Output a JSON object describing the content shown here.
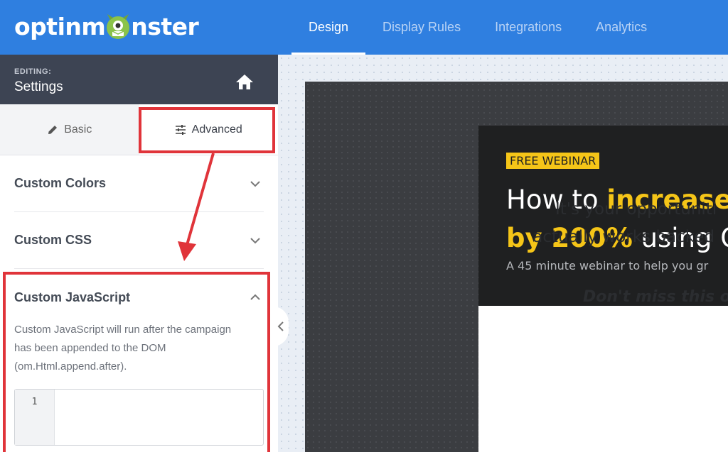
{
  "app": {
    "logo_text_left": "optinm",
    "logo_text_right": "nster",
    "accent_color": "#2f7fe0"
  },
  "nav": {
    "tabs": [
      {
        "label": "Design",
        "active": true
      },
      {
        "label": "Display Rules",
        "active": false
      },
      {
        "label": "Integrations",
        "active": false
      },
      {
        "label": "Analytics",
        "active": false
      }
    ]
  },
  "sidebar": {
    "editing_label": "EDITING:",
    "editing_title": "Settings",
    "home_icon": "home-icon",
    "subtabs": [
      {
        "label": "Basic",
        "icon": "pencil-icon",
        "active": false
      },
      {
        "label": "Advanced",
        "icon": "sliders-icon",
        "active": true
      }
    ],
    "sections": [
      {
        "title": "Custom Colors",
        "expanded": false
      },
      {
        "title": "Custom CSS",
        "expanded": false
      },
      {
        "title": "Custom JavaScript",
        "expanded": true
      }
    ],
    "js_description": "Custom JavaScript will run after the campaign has been appended to the DOM (om.Html.append.after).",
    "js_description_lines": [
      "Custom JavaScript will run after the campaign",
      "has been appended to the DOM",
      "(om.Html.append.after)."
    ],
    "editor_line_number": "1"
  },
  "preview": {
    "badge": "FREE WEBINAR",
    "headline_1a": "How to ",
    "headline_1b": "increase",
    "headline_2a": "by 200%",
    "headline_2b": " using O",
    "subline": "A 45 minute webinar to help you gr",
    "body_line_1": "It's your opportuniti",
    "body_line_2": "actually works backed",
    "italic_line": "Don't miss this o",
    "highlight_color": "#f5c518"
  },
  "annotations": {
    "color": "#e0343a"
  }
}
